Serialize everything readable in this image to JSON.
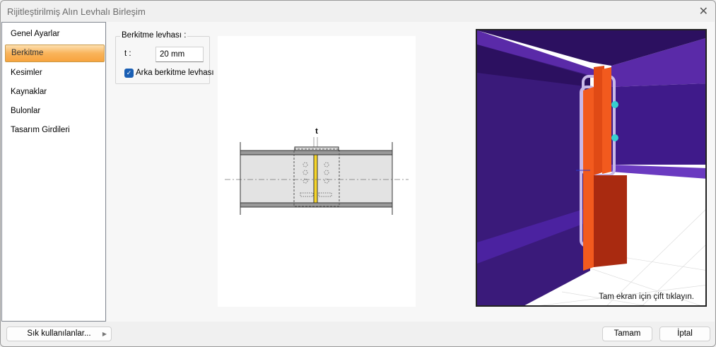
{
  "window": {
    "title": "Rijitleştirilmiş Alın Levhalı Birleşim",
    "close": "✕"
  },
  "sidebar": {
    "items": [
      {
        "label": "Genel Ayarlar",
        "selected": false
      },
      {
        "label": "Berkitme",
        "selected": true
      },
      {
        "label": "Kesimler",
        "selected": false
      },
      {
        "label": "Kaynaklar",
        "selected": false
      },
      {
        "label": "Bulonlar",
        "selected": false
      },
      {
        "label": "Tasarım Girdileri",
        "selected": false
      }
    ]
  },
  "stiffener": {
    "group_label": "Berkitme levhası :",
    "t_label": "t :",
    "t_value": "20 mm",
    "back_plate_label": "Arka berkitme levhası",
    "back_plate_checked": true
  },
  "drawing": {
    "dim_label": "t"
  },
  "viewport": {
    "hint": "Tam ekran için çift tıklayın."
  },
  "footer": {
    "favorites": "Sık kullanılanlar...",
    "ok": "Tamam",
    "cancel": "İptal"
  }
}
